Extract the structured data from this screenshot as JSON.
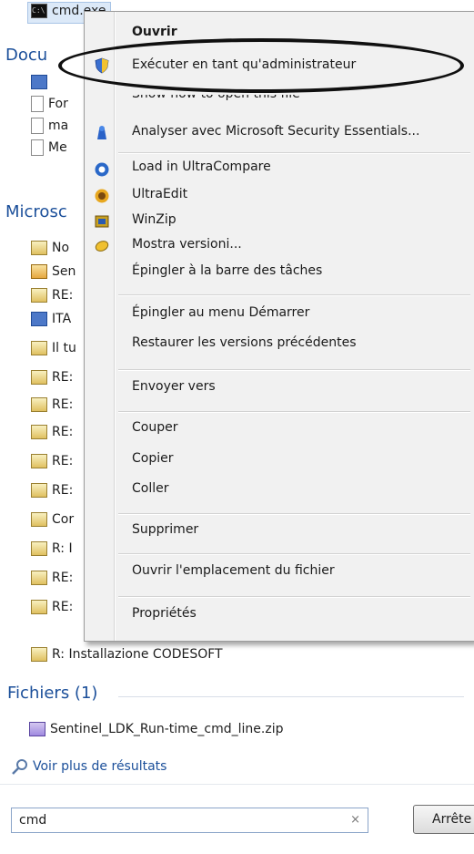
{
  "top_item": {
    "label": "cmd.exe"
  },
  "categories": {
    "documents": "Docu",
    "microsoft": "Microsc",
    "files": "Fichiers (1)"
  },
  "doc_items": [
    {
      "label": "",
      "icon": "word-doc-icon"
    },
    {
      "label": "For",
      "icon": "document-icon"
    },
    {
      "label": "ma",
      "icon": "document-icon"
    },
    {
      "label": "Me",
      "icon": "document-icon"
    }
  ],
  "mail_items": [
    {
      "label": "No",
      "icon": "envelope-icon"
    },
    {
      "label": "Sen",
      "icon": "task-icon"
    },
    {
      "label": "RE:",
      "icon": "envelope-icon"
    },
    {
      "label": "ITA",
      "icon": "calendar-icon"
    },
    {
      "label": "Il tu",
      "icon": "envelope-icon"
    },
    {
      "label": "RE:",
      "icon": "envelope-icon"
    },
    {
      "label": "RE:",
      "icon": "envelope-icon"
    },
    {
      "label": "RE:",
      "icon": "envelope-icon"
    },
    {
      "label": "RE:",
      "icon": "envelope-icon"
    },
    {
      "label": "RE:",
      "icon": "envelope-icon"
    },
    {
      "label": "Cor",
      "icon": "envelope-icon"
    },
    {
      "label": "R: I",
      "icon": "envelope-icon"
    },
    {
      "label": "RE:",
      "icon": "envelope-icon"
    },
    {
      "label": "RE:",
      "icon": "envelope-icon"
    },
    {
      "label": "R: Installazione CODESOFT",
      "icon": "envelope-icon"
    }
  ],
  "file_item": {
    "label": "Sentinel_LDK_Run-time_cmd_line.zip"
  },
  "more_results": "Voir plus de résultats",
  "search": {
    "value": "cmd",
    "clear": "×"
  },
  "stop_button": "Arrête",
  "context_menu": {
    "open": "Ouvrir",
    "run_as_admin": "Exécuter en tant qu'administrateur",
    "show_how": "Show how to open this file",
    "analyze": "Analyser avec Microsoft Security Essentials...",
    "ultracompare": "Load in UltraCompare",
    "ultraedit": "UltraEdit",
    "winzip": "WinZip",
    "versions": "Mostra versioni...",
    "pin_taskbar": "Épingler à la barre des tâches",
    "pin_start": "Épingler au menu Démarrer",
    "restore": "Restaurer les versions précédentes",
    "send_to": "Envoyer vers",
    "cut": "Couper",
    "copy": "Copier",
    "paste": "Coller",
    "delete": "Supprimer",
    "open_location": "Ouvrir l'emplacement du fichier",
    "properties": "Propriétés"
  }
}
